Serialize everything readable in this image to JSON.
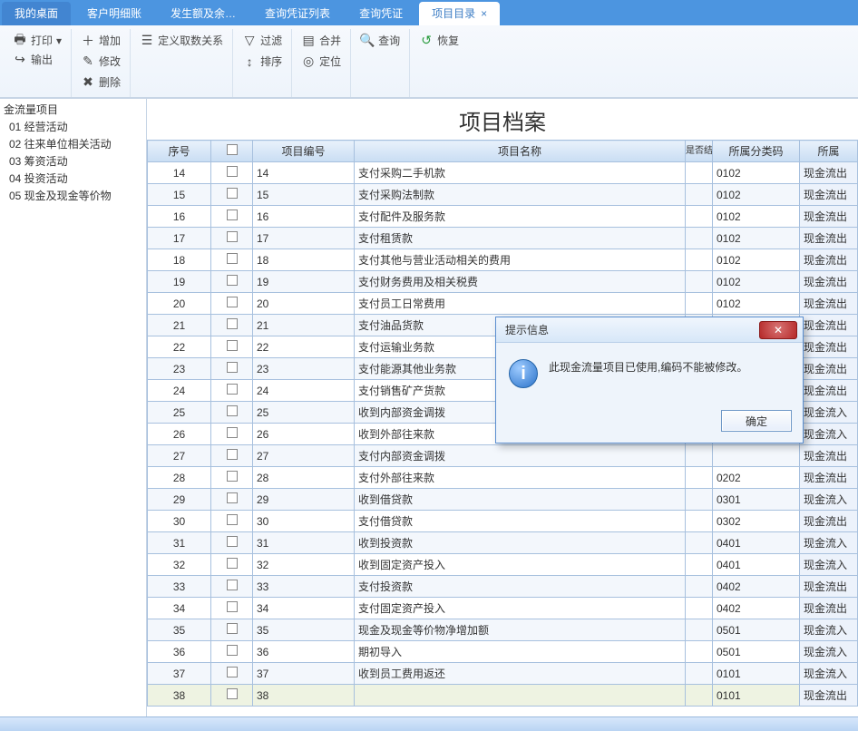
{
  "tabs": [
    {
      "label": "我的桌面",
      "first": true
    },
    {
      "label": "客户明细账"
    },
    {
      "label": "发生额及余…"
    },
    {
      "label": "查询凭证列表"
    },
    {
      "label": "查询凭证"
    },
    {
      "label": "项目目录",
      "active": true,
      "closable": true
    }
  ],
  "toolbar": {
    "print": "打印",
    "output": "输出",
    "add": "增加",
    "modify": "修改",
    "delete": "删除",
    "define": "定义取数关系",
    "filter": "过滤",
    "sort": "排序",
    "merge": "合并",
    "locate": "定位",
    "query": "查询",
    "restore": "恢复"
  },
  "tree": {
    "root": "金流量项目",
    "children": [
      "01 经营活动",
      "02 往来单位相关活动",
      "03 筹资活动",
      "04 投资活动",
      "05 现金及现金等价物"
    ]
  },
  "title": "项目档案",
  "columns": {
    "seq": "序号",
    "chk": "",
    "code": "项目编号",
    "name": "项目名称",
    "settle": "是否结算",
    "class": "所属分类码",
    "type": "所属"
  },
  "rows": [
    {
      "seq": "14",
      "code": "14",
      "name": "支付采购二手机款",
      "class": "0102",
      "type": "现金流出"
    },
    {
      "seq": "15",
      "code": "15",
      "name": "支付采购法制款",
      "class": "0102",
      "type": "现金流出"
    },
    {
      "seq": "16",
      "code": "16",
      "name": "支付配件及服务款",
      "class": "0102",
      "type": "现金流出"
    },
    {
      "seq": "17",
      "code": "17",
      "name": "支付租赁款",
      "class": "0102",
      "type": "现金流出"
    },
    {
      "seq": "18",
      "code": "18",
      "name": "支付其他与营业活动相关的费用",
      "class": "0102",
      "type": "现金流出"
    },
    {
      "seq": "19",
      "code": "19",
      "name": "支付财务费用及相关税费",
      "class": "0102",
      "type": "现金流出"
    },
    {
      "seq": "20",
      "code": "20",
      "name": "支付员工日常费用",
      "class": "0102",
      "type": "现金流出"
    },
    {
      "seq": "21",
      "code": "21",
      "name": "支付油品货款",
      "class": "",
      "type": "现金流出"
    },
    {
      "seq": "22",
      "code": "22",
      "name": "支付运输业务款",
      "class": "",
      "type": "现金流出"
    },
    {
      "seq": "23",
      "code": "23",
      "name": "支付能源其他业务款",
      "class": "",
      "type": "现金流出"
    },
    {
      "seq": "24",
      "code": "24",
      "name": "支付销售矿产货款",
      "class": "",
      "type": "现金流出"
    },
    {
      "seq": "25",
      "code": "25",
      "name": "收到内部资金调拨",
      "class": "",
      "type": "现金流入"
    },
    {
      "seq": "26",
      "code": "26",
      "name": "收到外部往来款",
      "class": "",
      "type": "现金流入"
    },
    {
      "seq": "27",
      "code": "27",
      "name": "支付内部资金调拨",
      "class": "",
      "type": "现金流出"
    },
    {
      "seq": "28",
      "code": "28",
      "name": "支付外部往来款",
      "class": "0202",
      "type": "现金流出"
    },
    {
      "seq": "29",
      "code": "29",
      "name": "收到借贷款",
      "class": "0301",
      "type": "现金流入"
    },
    {
      "seq": "30",
      "code": "30",
      "name": "支付借贷款",
      "class": "0302",
      "type": "现金流出"
    },
    {
      "seq": "31",
      "code": "31",
      "name": "收到投资款",
      "class": "0401",
      "type": "现金流入"
    },
    {
      "seq": "32",
      "code": "32",
      "name": "收到固定资产投入",
      "class": "0401",
      "type": "现金流入"
    },
    {
      "seq": "33",
      "code": "33",
      "name": "支付投资款",
      "class": "0402",
      "type": "现金流出"
    },
    {
      "seq": "34",
      "code": "34",
      "name": "支付固定资产投入",
      "class": "0402",
      "type": "现金流出"
    },
    {
      "seq": "35",
      "code": "35",
      "name": "现金及现金等价物净增加额",
      "class": "0501",
      "type": "现金流入"
    },
    {
      "seq": "36",
      "code": "36",
      "name": "期初导入",
      "class": "0501",
      "type": "现金流入"
    },
    {
      "seq": "37",
      "code": "37",
      "name": "收到员工费用返还",
      "class": "0101",
      "type": "现金流入"
    },
    {
      "seq": "38",
      "code": "38",
      "name": "",
      "class": "0101",
      "type": "现金流出",
      "sel": true
    }
  ],
  "dialog": {
    "title": "提示信息",
    "message": "此现金流量项目已使用,编码不能被修改。",
    "ok": "确定"
  }
}
